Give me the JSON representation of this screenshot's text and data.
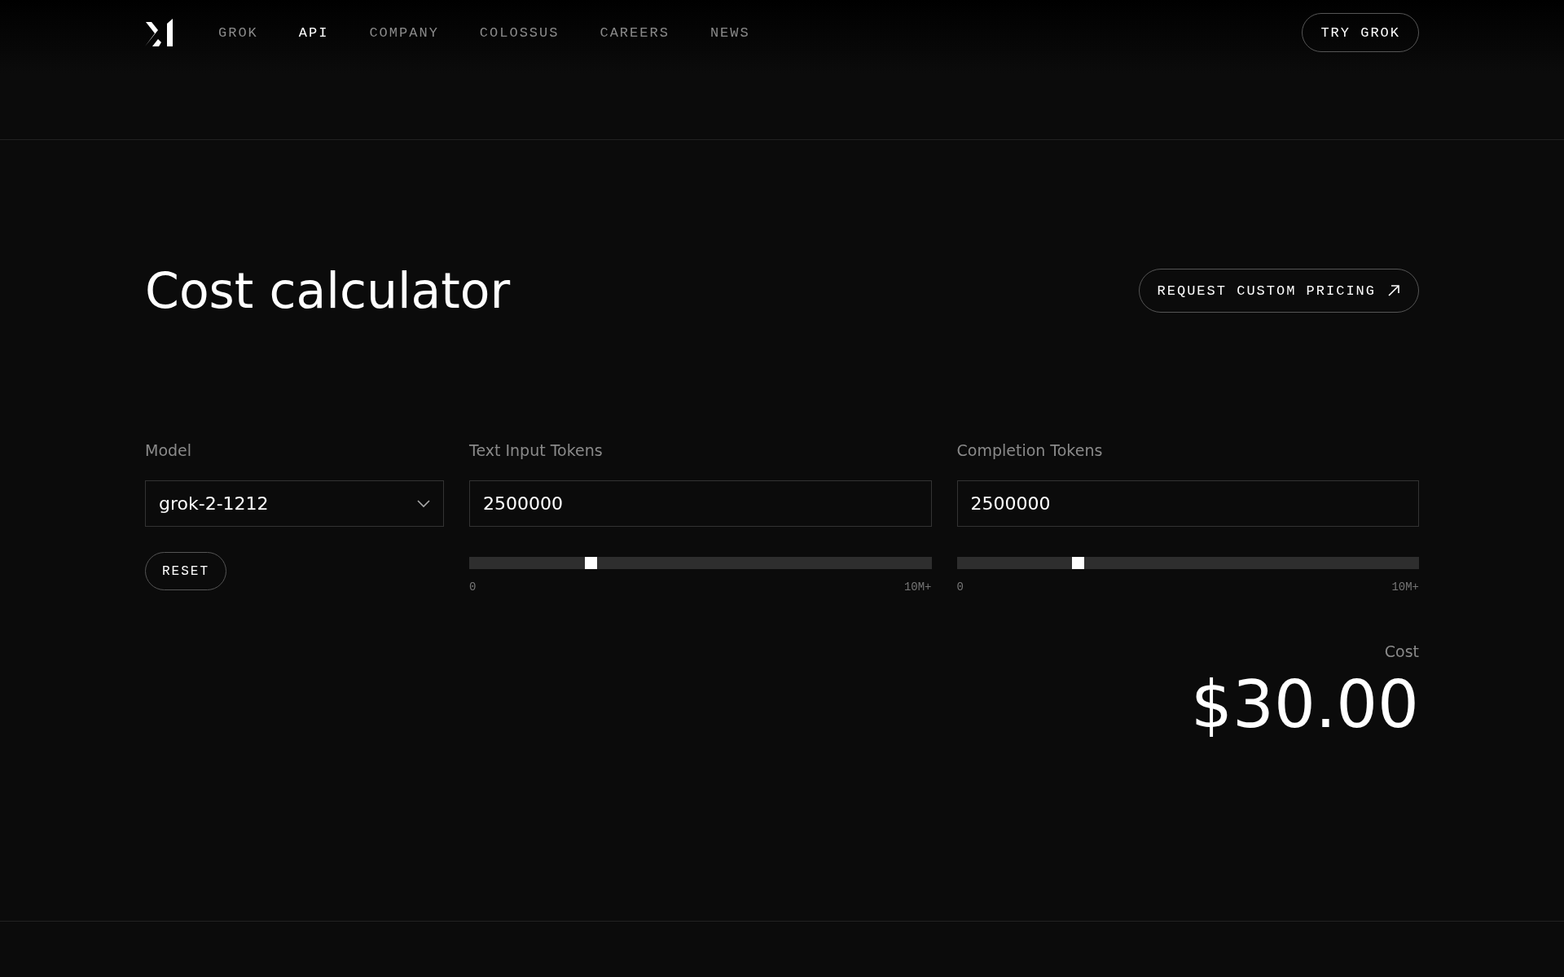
{
  "nav": {
    "items": [
      {
        "label": "GROK",
        "selected": false
      },
      {
        "label": "API",
        "selected": true
      },
      {
        "label": "COMPANY",
        "selected": false
      },
      {
        "label": "COLOSSUS",
        "selected": false
      },
      {
        "label": "CAREERS",
        "selected": false
      },
      {
        "label": "NEWS",
        "selected": false
      }
    ],
    "cta": "TRY GROK"
  },
  "title": "Cost calculator",
  "custom_pricing": "REQUEST CUSTOM PRICING",
  "model": {
    "label": "Model",
    "value": "grok-2-1212",
    "reset": "RESET"
  },
  "sliders": [
    {
      "label": "Text Input Tokens",
      "value": "2500000",
      "level": 0.25,
      "min": "0",
      "max": "10M+"
    },
    {
      "label": "Completion Tokens",
      "value": "2500000",
      "level": 0.25,
      "min": "0",
      "max": "10M+"
    }
  ],
  "cost": {
    "label": "Cost",
    "amount": "$30.00"
  }
}
